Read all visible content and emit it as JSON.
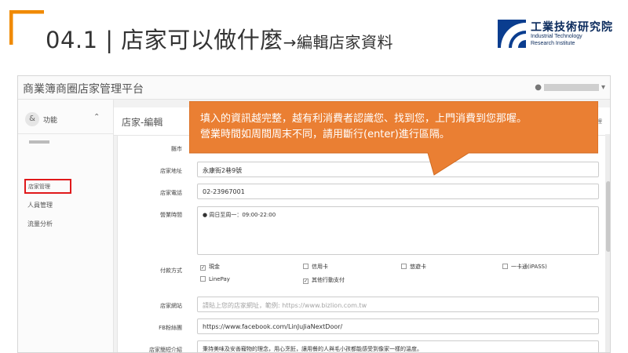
{
  "slide": {
    "title_main": "04.1 | 店家可以做什麼",
    "title_sub": "→編輯店家資料",
    "accent_color": "#f08a00"
  },
  "logo": {
    "name": "工業技術研究院",
    "english_line1": "Industrial Technology",
    "english_line2": "Research Institute",
    "color": "#0a2a5c"
  },
  "app": {
    "platform_title": "商業簿商圈店家管理平台",
    "user_icon": "person-icon",
    "user_caret": "▾"
  },
  "sidebar": {
    "avatar_icon": "ampersand-icon",
    "function_label": "功能",
    "collapse_icon": "chevron-up-icon",
    "items": [
      {
        "label": "店家管理",
        "active": true
      },
      {
        "label": "人員管理",
        "active": false
      },
      {
        "label": "流量分析",
        "active": false
      }
    ]
  },
  "content": {
    "page_title": "店家-編輯",
    "head_right": "哩"
  },
  "form": {
    "fields": {
      "region_label": "縣市",
      "address_label": "店家地址",
      "address_value": "永康街2巷9號",
      "phone_label": "店家電話",
      "phone_value": "02-23967001",
      "hours_label": "營業時間",
      "hours_value": "● 周日至周一：09:00-22:00",
      "payment_label": "付款方式",
      "website_label": "店家網站",
      "website_placeholder": "請貼上您的店家網址，範例: https://www.bizlion.com.tw",
      "fb_label": "FB粉絲團",
      "fb_value": "https://www.facebook.com/LinJuJiaNextDoor/",
      "intro_label": "店家簡短介紹",
      "intro_value": "秉持美味及安善寵物的理念，用心烹飪，讓用餐的人與毛小孩都能感受到像家一樣的溫度。"
    },
    "payment_options": [
      {
        "label": "現金",
        "checked": true
      },
      {
        "label": "信用卡",
        "checked": false
      },
      {
        "label": "悠遊卡",
        "checked": false
      },
      {
        "label": "一卡通(iPASS)",
        "checked": false
      },
      {
        "label": "LinePay",
        "checked": false
      },
      {
        "label": "其他行動支付",
        "checked": true
      }
    ]
  },
  "callout": {
    "line1": "填入的資訊越完整，越有利消費者認識您、找到您，上門消費到您那喔。",
    "line2": "營業時間如周間周末不同，請用斷行(enter)進行區隔。",
    "color": "#ea7f33"
  }
}
